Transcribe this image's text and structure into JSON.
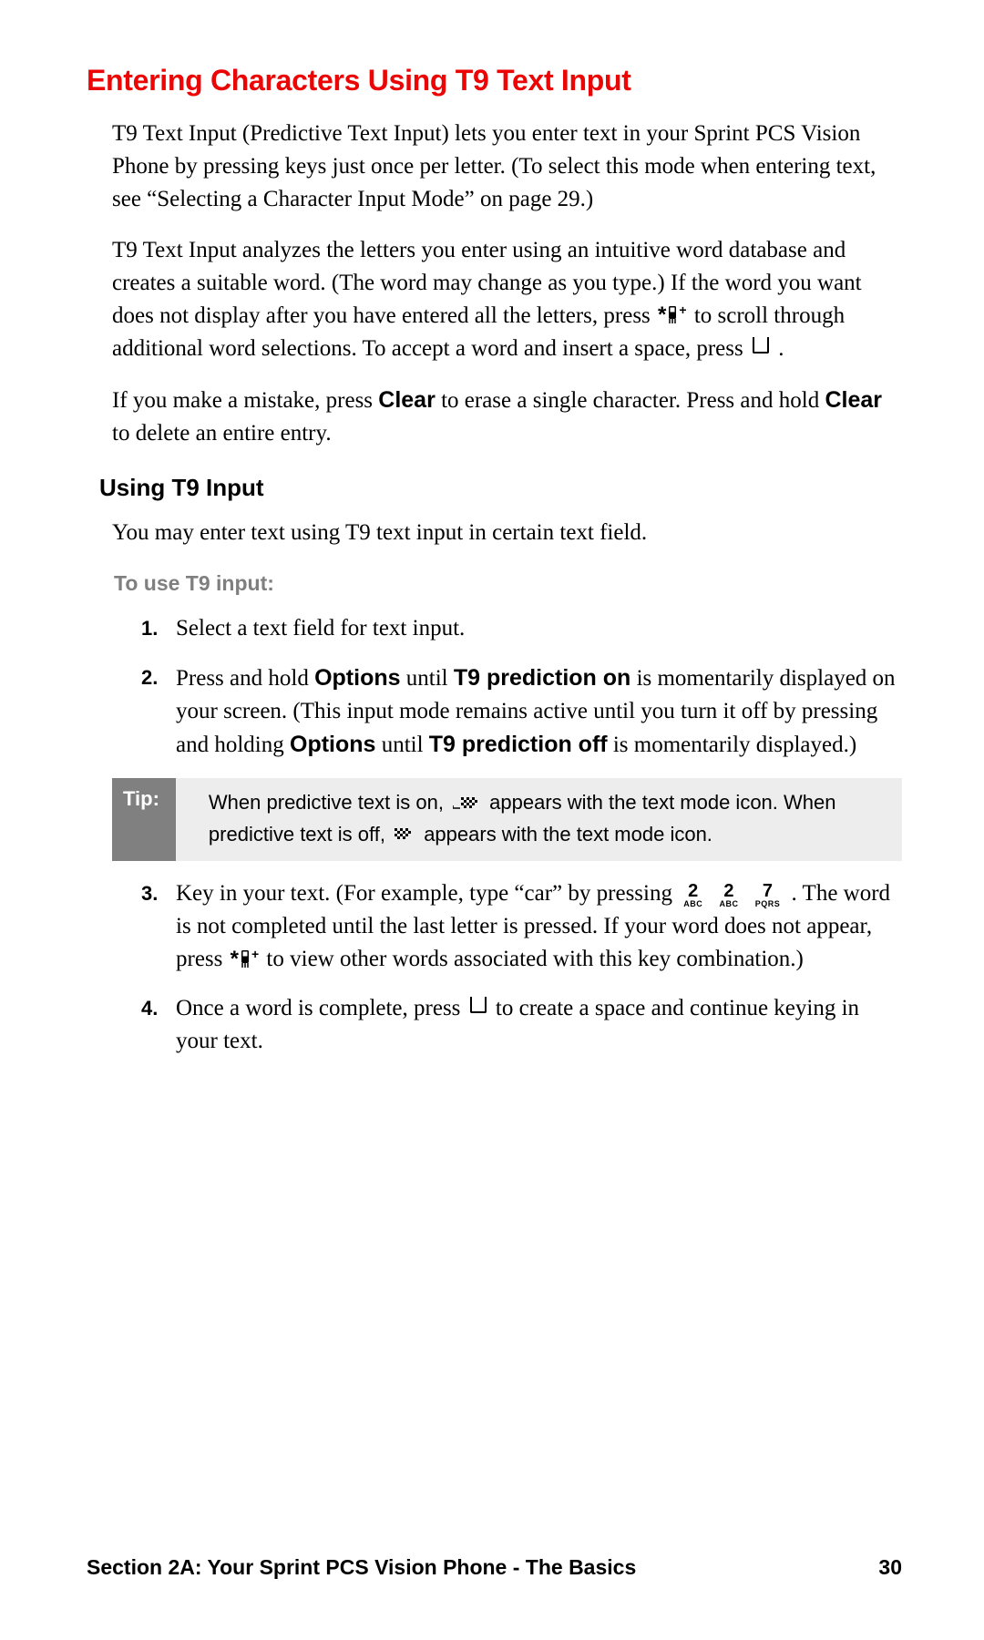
{
  "heading": "Entering Characters Using T9 Text Input",
  "para1_a": "T9 Text Input (Predictive Text Input) lets you enter text in your Sprint PCS Vision Phone by pressing keys just once per letter. (To select this mode when entering text, see “Selecting a Character Input Mode” on page 29.)",
  "para2_a": "T9 Text Input analyzes the letters you enter using an intuitive word database and creates a suitable word. (The word may change as you type.) If the word you want does not display after you have entered all the letters, press ",
  "para2_b": " to scroll through additional word selections. To accept a word and insert a space, press ",
  "para2_c": ".",
  "para3_a": "If you make a mistake, press ",
  "para3_clear1": "Clear",
  "para3_b": " to erase a single character. Press and hold ",
  "para3_clear2": "Clear",
  "para3_c": " to delete an entire entry.",
  "subheading": "Using T9 Input",
  "subintro": "You may enter text using T9 text input in certain text field.",
  "steps_heading": "To use T9 input:",
  "step1": "Select a text field for text input.",
  "step2_a": "Press and hold ",
  "step2_options1": "Options",
  "step2_b": " until ",
  "step2_t9on": "T9 prediction on",
  "step2_c": " is momentarily displayed on your screen. (This input mode remains active until you turn it off by pressing and holding ",
  "step2_options2": "Options",
  "step2_d": " until ",
  "step2_t9off": "T9 prediction off",
  "step2_e": " is momentarily displayed.)",
  "tip_label": "Tip:",
  "tip_a": "When predictive text is on, ",
  "tip_b": " appears with the text mode icon.  When predictive text is off, ",
  "tip_c": " appears with the text mode icon.",
  "step3_a": "Key in your text. (For example, type “car” by pressing ",
  "step3_b": ". The word is not completed until the last letter is pressed. If your word does not appear, press ",
  "step3_c": " to view other words associated with this key combination.)",
  "step4_a": "Once a word is complete, press ",
  "step4_b": " to create a space and continue keying in your text.",
  "key2_big": "2",
  "key2_small": "ABC",
  "key7_big": "7",
  "key7_small": "PQRS",
  "footer_text": "Section 2A: Your Sprint PCS Vision Phone - The Basics",
  "page_number": "30"
}
